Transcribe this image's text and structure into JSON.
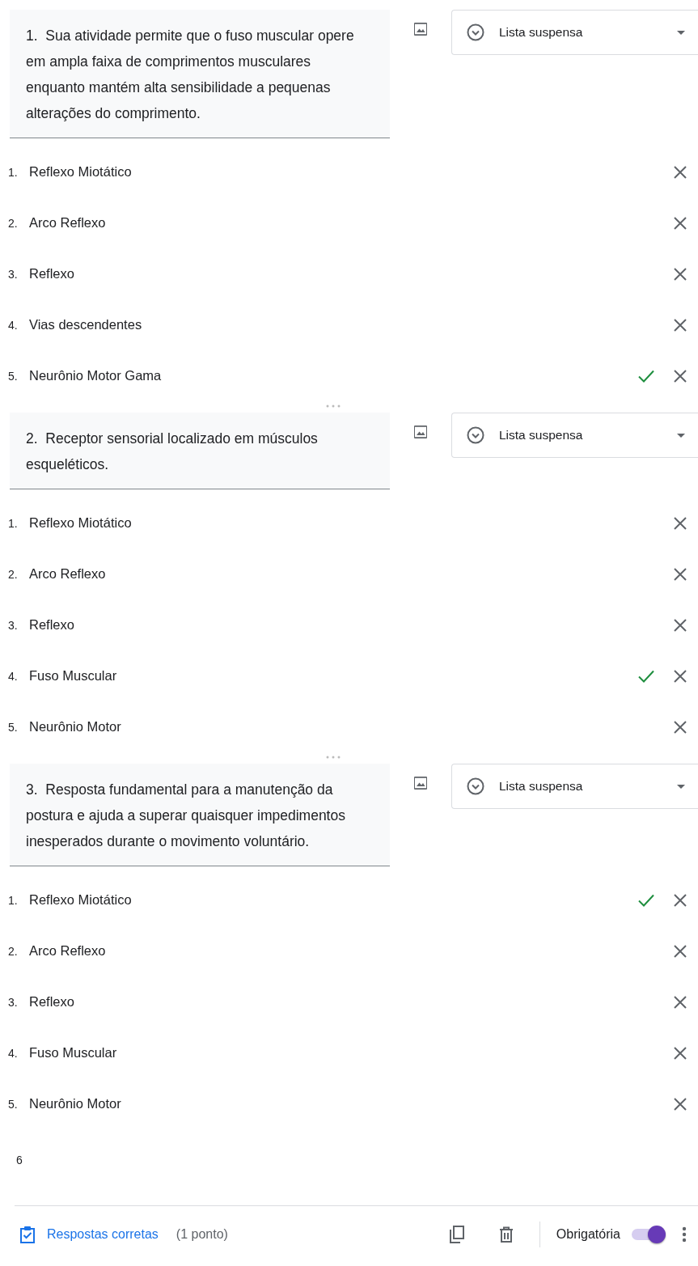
{
  "questions": [
    {
      "number": "1.",
      "text": "Sua atividade permite que o fuso muscular opere em ampla faixa de comprimentos musculares enquanto mantém alta sensibilidade a pequenas alterações do comprimento.",
      "type_label": "Lista suspensa",
      "options": [
        {
          "number": "1.",
          "label": "Reflexo Miotático",
          "correct": false
        },
        {
          "number": "2.",
          "label": "Arco Reflexo",
          "correct": false
        },
        {
          "number": "3.",
          "label": "Reflexo",
          "correct": false
        },
        {
          "number": "4.",
          "label": "Vias descendentes",
          "correct": false
        },
        {
          "number": "5.",
          "label": "Neurônio Motor Gama",
          "correct": true
        }
      ]
    },
    {
      "number": "2.",
      "text": "Receptor sensorial localizado em músculos esqueléticos.",
      "type_label": "Lista suspensa",
      "options": [
        {
          "number": "1.",
          "label": "Reflexo Miotático",
          "correct": false
        },
        {
          "number": "2.",
          "label": "Arco Reflexo",
          "correct": false
        },
        {
          "number": "3.",
          "label": "Reflexo",
          "correct": false
        },
        {
          "number": "4.",
          "label": "Fuso Muscular",
          "correct": true
        },
        {
          "number": "5.",
          "label": "Neurônio Motor",
          "correct": false
        }
      ]
    },
    {
      "number": "3.",
      "text": "Resposta fundamental para a manutenção da postura e ajuda a superar quaisquer impedimentos inesperados durante o movimento voluntário.",
      "type_label": "Lista suspensa",
      "options": [
        {
          "number": "1.",
          "label": "Reflexo Miotático",
          "correct": true
        },
        {
          "number": "2.",
          "label": "Arco Reflexo",
          "correct": false
        },
        {
          "number": "3.",
          "label": "Reflexo",
          "correct": false
        },
        {
          "number": "4.",
          "label": "Fuso Muscular",
          "correct": false
        },
        {
          "number": "5.",
          "label": "Neurônio Motor",
          "correct": false
        }
      ]
    }
  ],
  "next_number": "6",
  "footer": {
    "answers_link": "Respostas corretas",
    "points": "(1 ponto)",
    "required_label": "Obrigatória",
    "required_on": true
  }
}
